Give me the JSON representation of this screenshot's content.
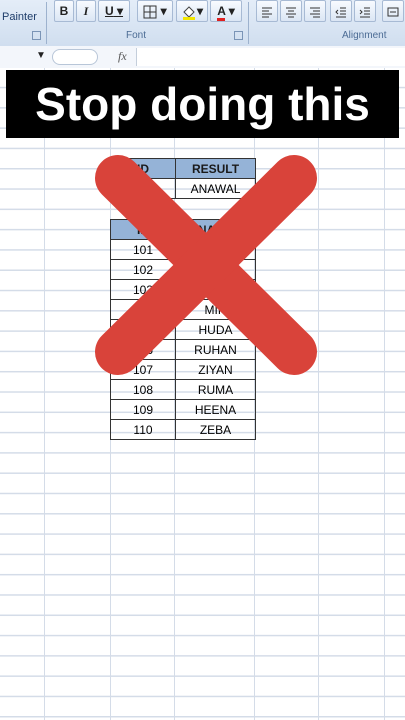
{
  "ribbon": {
    "clipboard_painter_label": "Painter",
    "font_group_label": "Font",
    "alignment_group_label": "Alignment",
    "bold_label": "B",
    "italic_label": "I",
    "underline_label": "U",
    "font_color_label": "A"
  },
  "formula_bar": {
    "fx_label": "fx"
  },
  "banner": {
    "text": "Stop doing this"
  },
  "table1": {
    "headers": [
      "ID",
      "RESULT"
    ],
    "rows": [
      [
        "",
        "ANAWAL"
      ]
    ]
  },
  "table2": {
    "headers": [
      "ID",
      "NAME"
    ],
    "rows": [
      [
        "101",
        ""
      ],
      [
        "102",
        ""
      ],
      [
        "103",
        ""
      ],
      [
        "104",
        "MIR"
      ],
      [
        "105",
        "HUDA"
      ],
      [
        "106",
        "RUHAN"
      ],
      [
        "107",
        "ZIYAN"
      ],
      [
        "108",
        "RUMA"
      ],
      [
        "109",
        "HEENA"
      ],
      [
        "110",
        "ZEBA"
      ]
    ]
  },
  "colors": {
    "x_mark": "#d9433a",
    "header_fill": "#95b3d7"
  }
}
